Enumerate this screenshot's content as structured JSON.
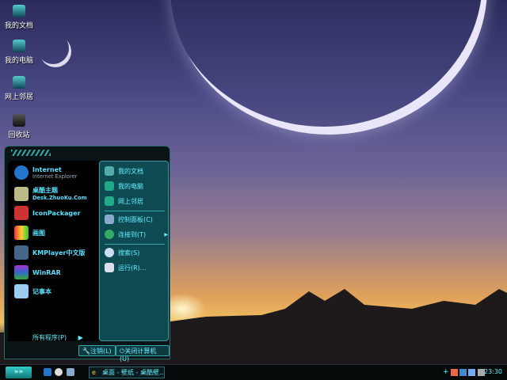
{
  "desktop": {
    "icons": [
      {
        "label": "我的文档"
      },
      {
        "label": "我的电脑"
      },
      {
        "label": "网上邻居"
      },
      {
        "label": "回收站"
      }
    ]
  },
  "start_menu": {
    "left_items": [
      {
        "title": "Internet",
        "subtitle": "Internet Explorer"
      },
      {
        "title": "桌酷主题",
        "subtitle": "Desk.ZhuoKu.Com"
      },
      {
        "title": "IconPackager"
      },
      {
        "title": "画图"
      },
      {
        "title": "KMPlayer中文版"
      },
      {
        "title": "WinRAR"
      },
      {
        "title": "记事本"
      }
    ],
    "all_programs": "所有程序(P)",
    "right_items": [
      "我的文档",
      "我的电脑",
      "网上邻居",
      "控制面板(C)",
      "连接到(T)",
      "搜索(S)",
      "运行(R)..."
    ],
    "logoff": "注销(L)",
    "shutdown": "关闭计算机(U)"
  },
  "taskbar": {
    "start_label": "»»",
    "task": "桌面 - 壁纸 - 桌酷壁...",
    "clock": "23:30"
  }
}
